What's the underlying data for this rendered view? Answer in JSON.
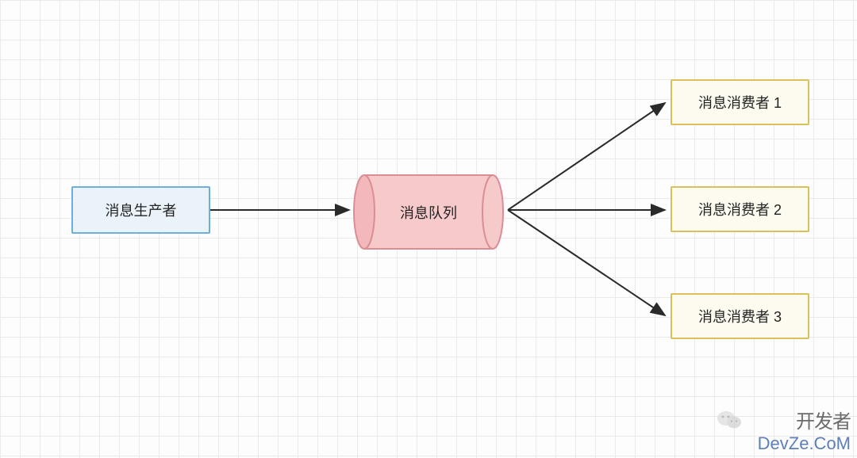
{
  "diagram": {
    "producer": {
      "label": "消息生产者"
    },
    "queue": {
      "label": "消息队列"
    },
    "consumers": [
      {
        "label": "消息消费者 1"
      },
      {
        "label": "消息消费者 2"
      },
      {
        "label": "消息消费者 3"
      }
    ]
  },
  "watermark": {
    "line1": "开发者",
    "line2": "DevZe.CoM"
  },
  "colors": {
    "producer_border": "#6faedb",
    "producer_fill": "#eaf3fa",
    "queue_border": "#da8e93",
    "queue_fill": "#f6c9cb",
    "consumer_border": "#d9c05a",
    "consumer_fill": "#fdfaef",
    "arrow": "#2a2a2a",
    "grid": "#eaeaea"
  }
}
